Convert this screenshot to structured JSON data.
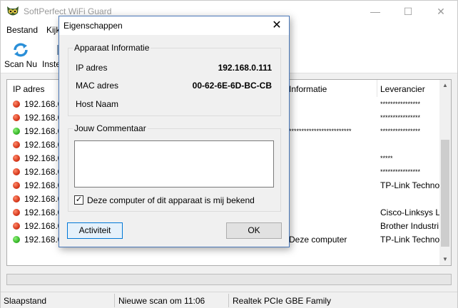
{
  "app": {
    "title": "SoftPerfect WiFi Guard",
    "min_glyph": "—",
    "max_glyph": "☐",
    "close_glyph": "✕"
  },
  "menu": {
    "file": "Bestand",
    "view": "Kijk"
  },
  "toolbar": {
    "scan_label": "Scan Nu",
    "settings_label": "Inste"
  },
  "list": {
    "headers": {
      "ip": "IP adres",
      "info": "Informatie",
      "vendor": "Leverancier"
    },
    "rows": [
      {
        "status": "red",
        "ip": "192.168.0.",
        "info": "",
        "vendor": "****************",
        "vendor_stars": true
      },
      {
        "status": "red",
        "ip": "192.168.0.",
        "info": "",
        "vendor": "****************",
        "vendor_stars": true
      },
      {
        "status": "green",
        "ip": "192.168.0.",
        "info": "*************************",
        "info_stars": true,
        "vendor": "****************",
        "vendor_stars": true
      },
      {
        "status": "red",
        "ip": "192.168.0.",
        "info": "",
        "vendor": ""
      },
      {
        "status": "red",
        "ip": "192.168.0.",
        "info": "",
        "vendor": "*****",
        "vendor_stars": true
      },
      {
        "status": "red",
        "ip": "192.168.0.",
        "info": "",
        "vendor": "****************",
        "vendor_stars": true
      },
      {
        "status": "red",
        "ip": "192.168.0.",
        "info": "",
        "vendor": "TP-Link Techno"
      },
      {
        "status": "red",
        "ip": "192.168.0.",
        "info": "",
        "vendor": ""
      },
      {
        "status": "red",
        "ip": "192.168.0.",
        "info": "",
        "vendor": "Cisco-Linksys L"
      },
      {
        "status": "red",
        "ip": "192.168.0.",
        "info": "",
        "vendor": "Brother Industri"
      },
      {
        "status": "green",
        "ip": "192.168.0.",
        "info": "Deze computer",
        "vendor": "TP-Link Techno"
      }
    ]
  },
  "status": {
    "mode": "Slaapstand",
    "next_scan": "Nieuwe scan om 11:06",
    "adapter": "Realtek PCIe GBE Family"
  },
  "dialog": {
    "title": "Eigenschappen",
    "close_glyph": "✕",
    "device_group": "Apparaat Informatie",
    "ip_label": "IP adres",
    "ip_value": "192.168.0.111",
    "mac_label": "MAC adres",
    "mac_value": "00-62-6E-6D-BC-CB",
    "host_label": "Host Naam",
    "host_value": "",
    "comment_group": "Jouw Commentaar",
    "comment_value": "",
    "known_checkbox_label": "Deze computer of dit apparaat is mij bekend",
    "known_checked": true,
    "check_glyph": "✓",
    "activity_button": "Activiteit",
    "ok_button": "OK"
  },
  "colors": {
    "status_red": "#d6381c",
    "status_green": "#38b82a",
    "dialog_border": "#4a78b8",
    "focus_button_border": "#0078d7"
  }
}
